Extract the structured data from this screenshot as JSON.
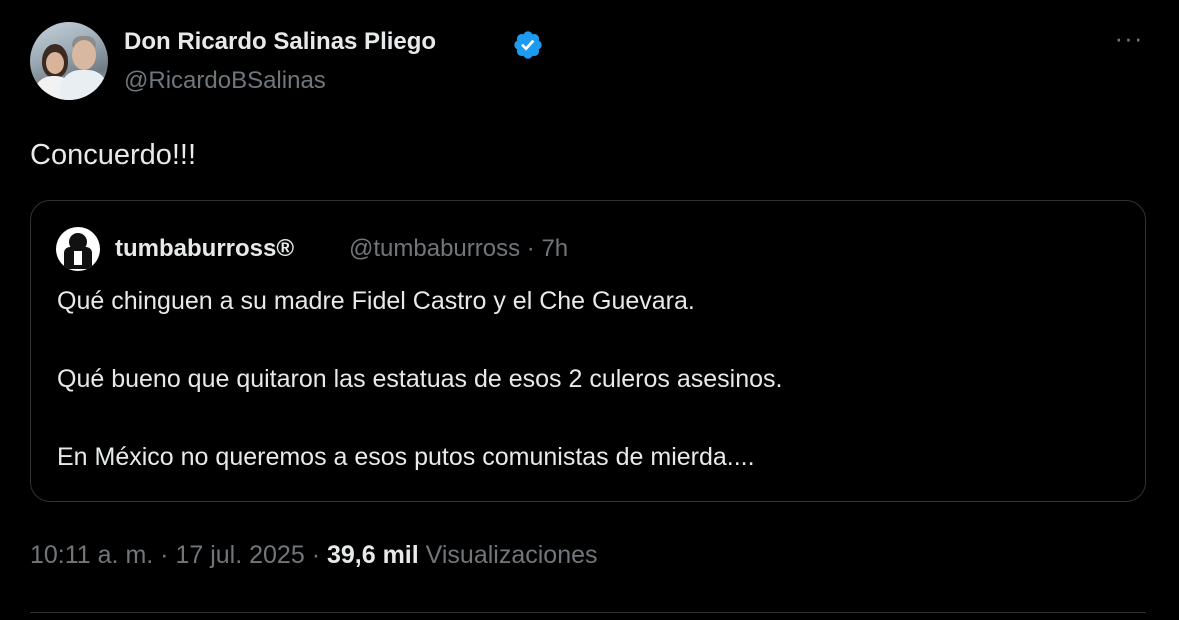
{
  "author": {
    "display_name": "Don Ricardo Salinas Pliego",
    "handle": "@RicardoBSalinas",
    "verified_icon": "verified-badge-icon",
    "verified_color": "#1d9bf0"
  },
  "more_label": "···",
  "tweet_text": "Concuerdo!!!",
  "quoted": {
    "display_name": "tumbaburross®",
    "handle": "@tumbaburross",
    "separator": "·",
    "time": "7h",
    "lines": [
      "Qué chinguen a su madre Fidel Castro y el Che Guevara.",
      "Qué bueno que quitaron las estatuas de esos 2 culeros asesinos.",
      "En México no queremos a esos putos comunistas de mierda...."
    ]
  },
  "footer": {
    "time": "10:11 a. m.",
    "sep1": "·",
    "date": "17 jul. 2025",
    "sep2": "·",
    "views_count": "39,6 mil",
    "views_label": "Visualizaciones"
  },
  "colors": {
    "background": "#000000",
    "primary_text": "#e7e9ea",
    "secondary_text": "#71767b",
    "border": "#2f3336"
  }
}
